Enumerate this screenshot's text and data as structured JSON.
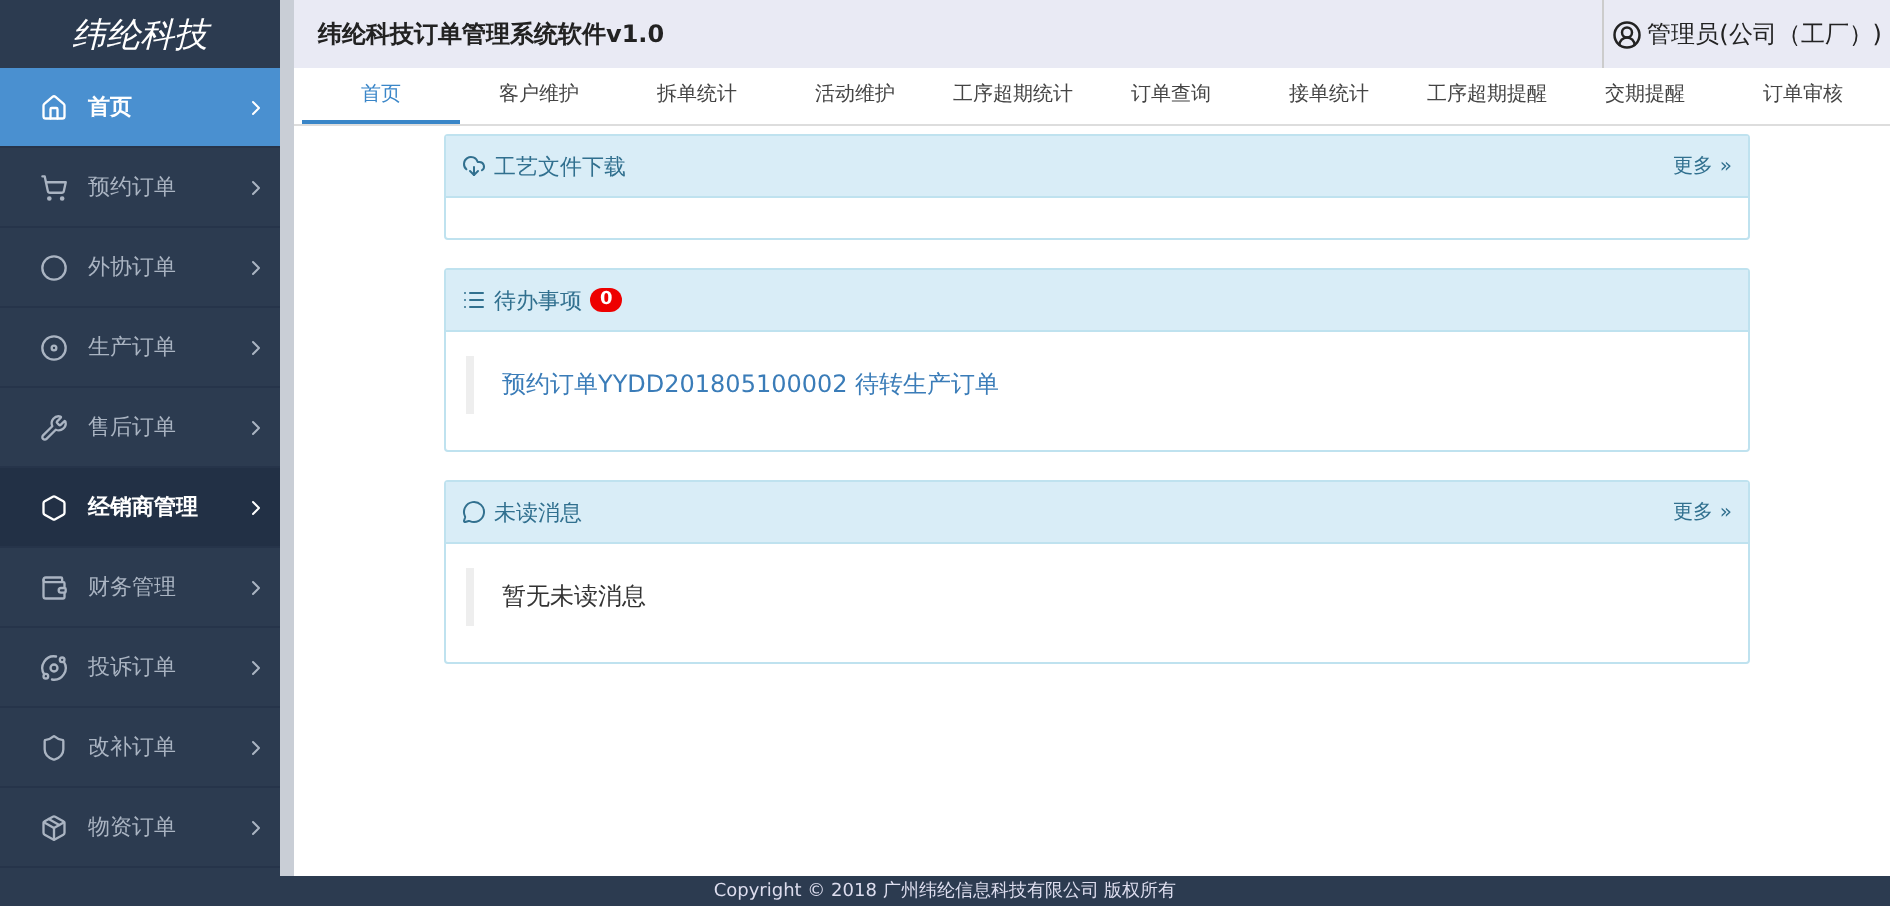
{
  "sidebar": {
    "logo": "纬纶科技",
    "items": [
      {
        "label": "首页",
        "selected": true,
        "hovered": false
      },
      {
        "label": "预约订单",
        "selected": false,
        "hovered": false
      },
      {
        "label": "外协订单",
        "selected": false,
        "hovered": false
      },
      {
        "label": "生产订单",
        "selected": false,
        "hovered": false
      },
      {
        "label": "售后订单",
        "selected": false,
        "hovered": false
      },
      {
        "label": "经销商管理",
        "selected": false,
        "hovered": true
      },
      {
        "label": "财务管理",
        "selected": false,
        "hovered": false
      },
      {
        "label": "投诉订单",
        "selected": false,
        "hovered": false
      },
      {
        "label": "改补订单",
        "selected": false,
        "hovered": false
      },
      {
        "label": "物资订单",
        "selected": false,
        "hovered": false
      }
    ]
  },
  "header": {
    "title": "纬纶科技订单管理系统软件v1.0",
    "user": "管理员(公司（工厂）)"
  },
  "tabs": [
    {
      "label": "首页",
      "selected": true
    },
    {
      "label": "客户维护",
      "selected": false
    },
    {
      "label": "拆单统计",
      "selected": false
    },
    {
      "label": "活动维护",
      "selected": false
    },
    {
      "label": "工序超期统计",
      "selected": false
    },
    {
      "label": "订单查询",
      "selected": false
    },
    {
      "label": "接单统计",
      "selected": false
    },
    {
      "label": "工序超期提醒",
      "selected": false
    },
    {
      "label": "交期提醒",
      "selected": false
    },
    {
      "label": "订单审核",
      "selected": false
    }
  ],
  "panels": [
    {
      "kind": "download",
      "title": "工艺文件下载",
      "more": "更多 »"
    },
    {
      "kind": "todo",
      "title": "待办事项",
      "badge": "0",
      "items": [
        "预约订单YYDD201805100002 待转生产订单"
      ]
    },
    {
      "kind": "messages",
      "title": "未读消息",
      "more": "更多 »",
      "items": [
        "暂无未读消息"
      ]
    }
  ],
  "footer": "Copyright © 2018 广州纬纶信息科技有限公司 版权所有"
}
